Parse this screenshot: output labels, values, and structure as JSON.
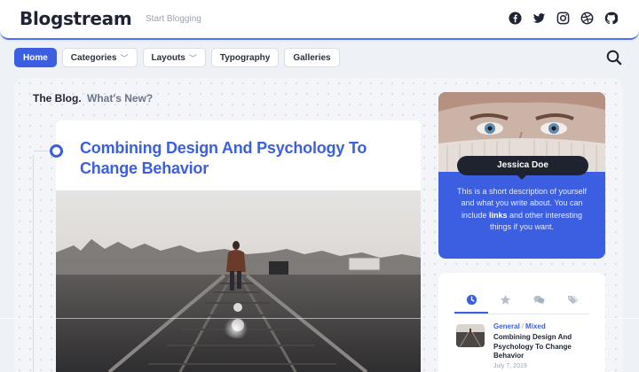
{
  "header": {
    "logo": "Blogstream",
    "tagline": "Start Blogging",
    "social_icons": [
      "facebook-icon",
      "twitter-icon",
      "instagram-icon",
      "dribbble-icon",
      "github-icon"
    ]
  },
  "nav": {
    "items": [
      {
        "label": "Home",
        "active": true,
        "dropdown": false
      },
      {
        "label": "Categories",
        "active": false,
        "dropdown": true
      },
      {
        "label": "Layouts",
        "active": false,
        "dropdown": true
      },
      {
        "label": "Typography",
        "active": false,
        "dropdown": false
      },
      {
        "label": "Galleries",
        "active": false,
        "dropdown": false
      }
    ],
    "chevron": "﹀",
    "search_icon": "search-icon"
  },
  "blog": {
    "heading": "The Blog.",
    "subheading": "What's New?"
  },
  "article": {
    "title": "Combining Design And Psychology To Change Behavior",
    "image": "man-walking-on-railway-tracks"
  },
  "profile": {
    "name": "Jessica Doe",
    "desc_before": "This is a short description of yourself and what you write about. You can include ",
    "desc_link": "links",
    "desc_after": " and other interesting things if you want."
  },
  "posts_widget": {
    "tabs": [
      "clock-icon",
      "star-icon",
      "comments-icon",
      "tags-icon"
    ],
    "active_tab": 0,
    "post": {
      "category": "General",
      "separator": "/",
      "subcategory": "Mixed",
      "title": "Combining Design And Psychology To Change Behavior",
      "date": "July 7, 2019"
    }
  },
  "colors": {
    "accent": "#3b5fe0",
    "text_dark": "#1e2433",
    "background": "#eef1f6",
    "pill_dark": "#1f2330"
  }
}
